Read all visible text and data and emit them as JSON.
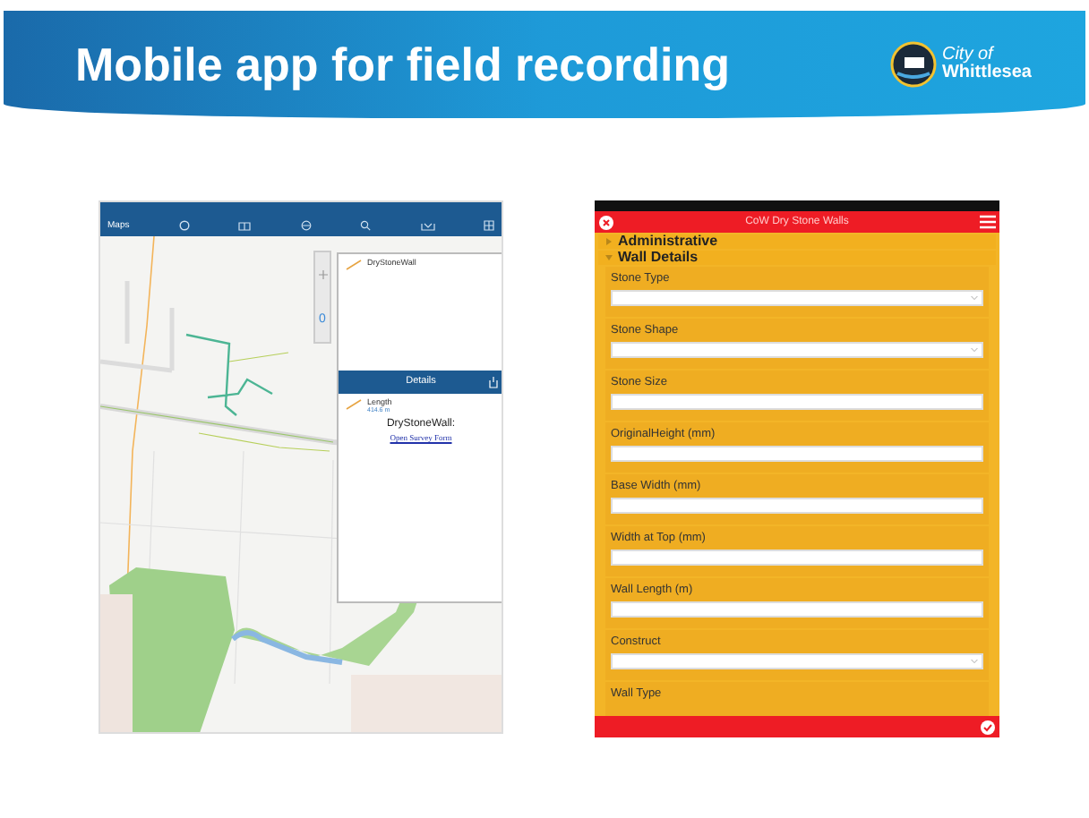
{
  "slide": {
    "title": "Mobile app for field recording",
    "logo": {
      "line_1": "City of",
      "line_2": "Whittlesea"
    }
  },
  "map_app": {
    "nav": {
      "label": "Maps"
    },
    "layer_panel": {
      "layer": "DryStoneWall"
    },
    "details": {
      "title": "Details",
      "field": "Length",
      "value": "414.6 m",
      "feature": "DryStoneWall:",
      "link": "Open Survey Form"
    },
    "zoom_level": "0"
  },
  "form_app": {
    "title": "CoW Dry Stone Walls",
    "sections": [
      {
        "label": "Administrative",
        "expanded": false
      },
      {
        "label": "Wall Details",
        "expanded": true
      }
    ],
    "fields": [
      {
        "label": "Stone Type",
        "kind": "select"
      },
      {
        "label": "Stone Shape",
        "kind": "select"
      },
      {
        "label": "Stone Size",
        "kind": "text"
      },
      {
        "label": "OriginalHeight (mm)",
        "kind": "text"
      },
      {
        "label": "Base Width (mm)",
        "kind": "text"
      },
      {
        "label": "Width at Top (mm)",
        "kind": "text"
      },
      {
        "label": "Wall Length (m)",
        "kind": "text"
      },
      {
        "label": "Construct",
        "kind": "select"
      },
      {
        "label": "Wall Type",
        "kind": "label"
      }
    ]
  }
}
